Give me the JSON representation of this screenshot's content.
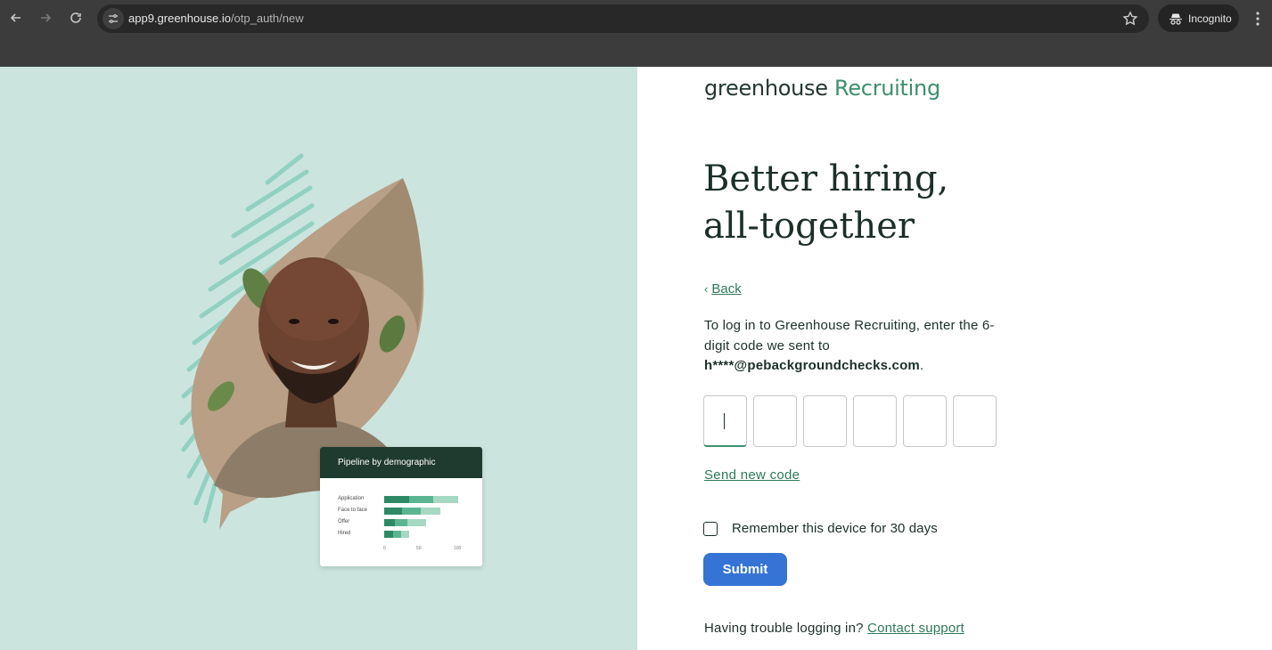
{
  "browser": {
    "url_host": "app9.greenhouse.io",
    "url_path": "/otp_auth/new",
    "incognito_label": "Incognito"
  },
  "illustration": {
    "card_title": "Pipeline by demographic",
    "rows": [
      "Application",
      "Face to face",
      "Offer",
      "Hired"
    ],
    "axis_ticks": [
      "0",
      "50",
      "100"
    ],
    "colors": {
      "dark": "#2e8a66",
      "mid": "#5cb592",
      "light": "#a6d8c4",
      "bg": "#cbe5de"
    }
  },
  "brand": {
    "name": "greenhouse",
    "product": "Recruiting"
  },
  "headline": {
    "line1": "Better hiring,",
    "line2": "all-together"
  },
  "back_label": "Back",
  "instructions": {
    "text": "To log in to Greenhouse Recruiting, enter the 6-digit code we sent to",
    "email": "h****@pebackgroundchecks.com",
    "suffix": "."
  },
  "otp": {
    "digits": [
      "",
      "",
      "",
      "",
      "",
      ""
    ]
  },
  "send_new_code_label": "Send new code",
  "remember_label": "Remember this device for 30 days",
  "submit_label": "Submit",
  "trouble": {
    "text": "Having trouble logging in?",
    "link": "Contact support"
  },
  "colors": {
    "accent": "#3d8f6e",
    "button": "#3574d4",
    "text": "#1c2f27"
  }
}
